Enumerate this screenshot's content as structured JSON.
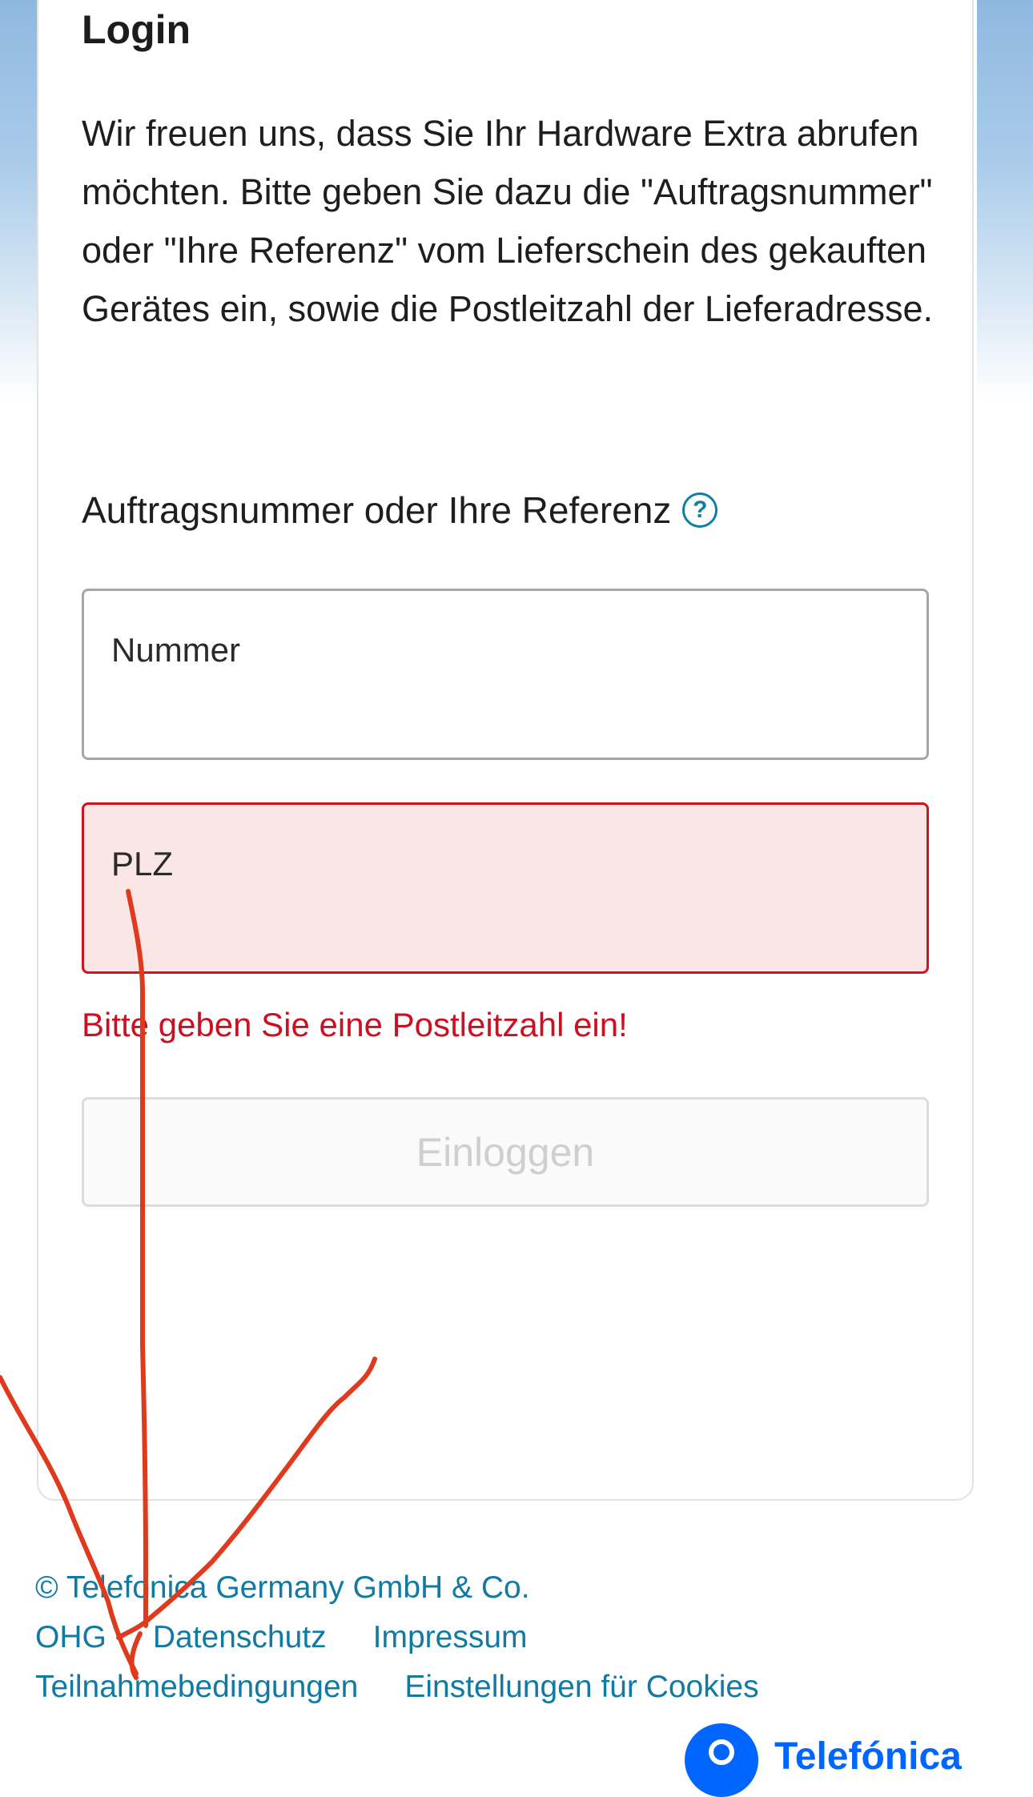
{
  "login": {
    "title": "Login",
    "intro": "Wir freuen uns, dass Sie Ihr Hardware Extra abrufen möchten. Bitte geben Sie dazu die \"Auftragsnummer\" oder \"Ihre Referenz\" vom Lieferschein des gekauften Gerätes ein, sowie die Postleitzahl der Lieferadresse.",
    "order_label": "Auftragsnummer oder Ihre Referenz",
    "help_icon": "question-circle-icon",
    "order_placeholder": "Nummer",
    "plz_placeholder": "PLZ",
    "plz_error": "Bitte geben Sie eine Postleitzahl ein!",
    "submit_label": "Einloggen"
  },
  "footer": {
    "copyright_line1": "© Telefonica Germany GmbH & Co.",
    "copyright_line2": "OHG",
    "links": {
      "privacy": "Datenschutz",
      "imprint": "Impressum",
      "terms": "Teilnahmebedingungen",
      "cookies": "Einstellungen für Cookies"
    }
  },
  "brand": {
    "name": "Telefónica",
    "logo_icon": "telefonica-logo-icon"
  },
  "colors": {
    "link": "#117aa3",
    "error": "#cc1021",
    "error_bg": "#fbe6e6",
    "brand": "#0066ff",
    "annotation": "#e03a1e"
  }
}
